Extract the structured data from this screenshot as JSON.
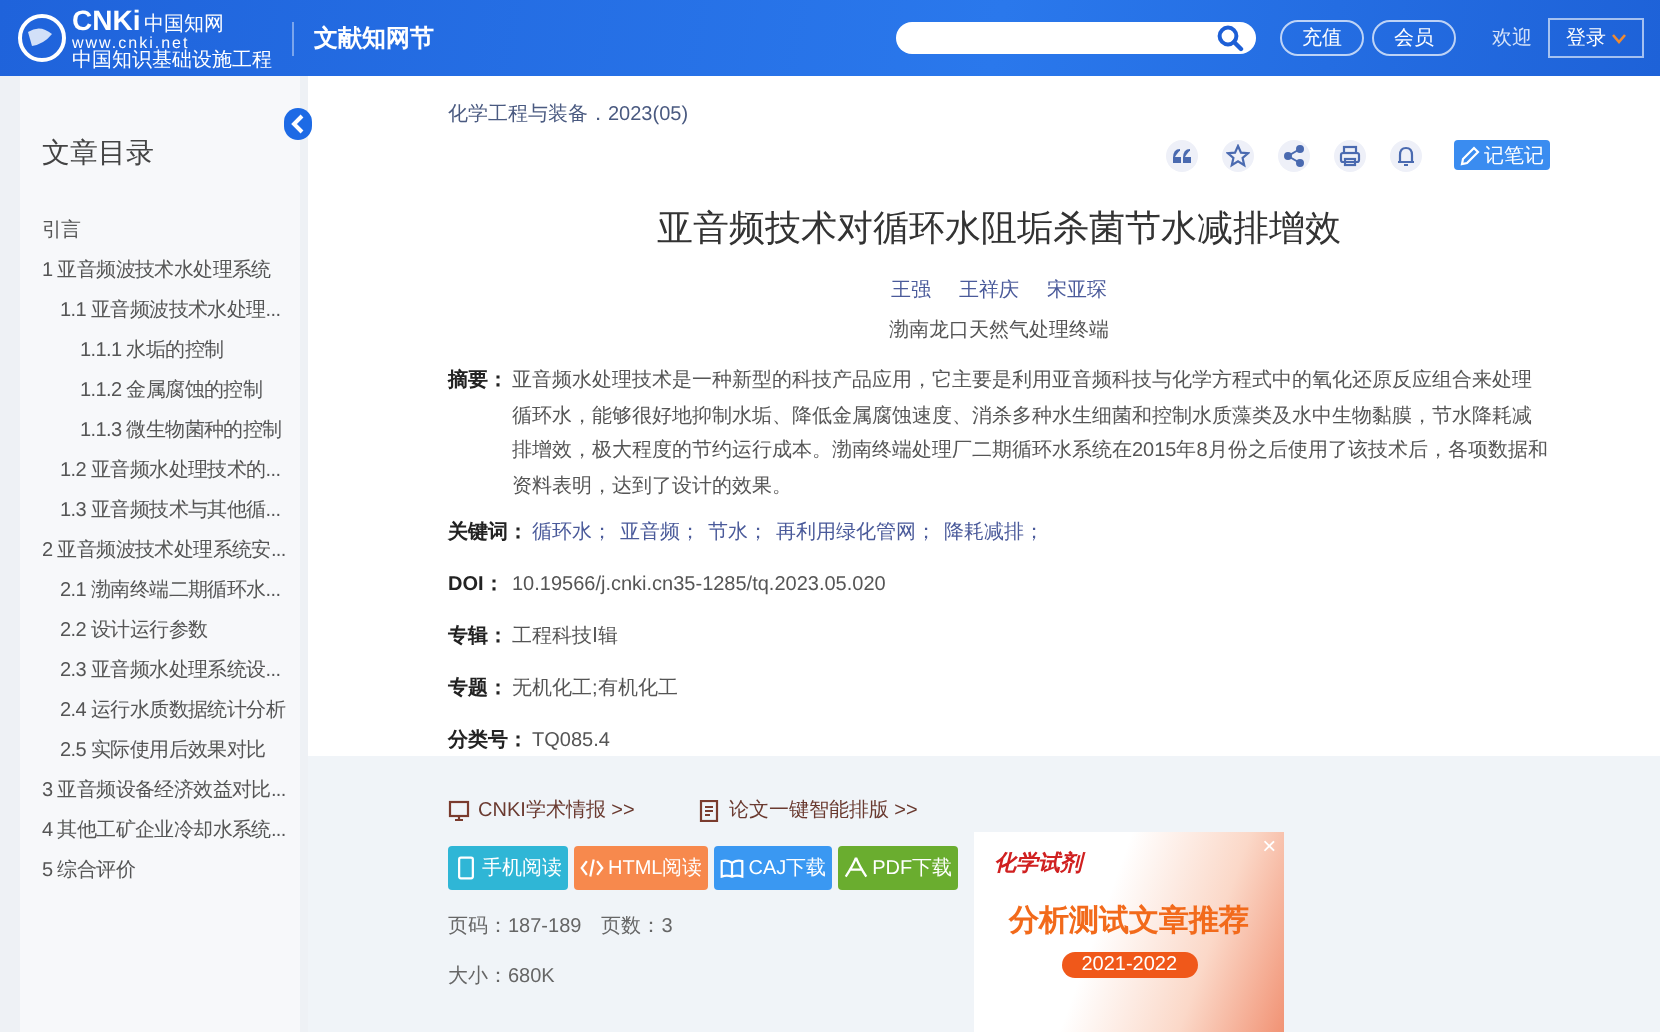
{
  "header": {
    "logo_mark": "CNKi",
    "logo_cn": "中国知网",
    "logo_url": "www.cnki.net",
    "logo_sub": "中国知识基础设施工程",
    "section": "文献知网节",
    "buttons": [
      "充值",
      "会员"
    ],
    "welcome": "欢迎",
    "login": "登录"
  },
  "toc": {
    "title": "文章目录",
    "items": [
      {
        "label": "引言"
      },
      {
        "label": "1 亚音频波技术水处理系统",
        "children": [
          {
            "label": "1.1 亚音频波技术水处理...",
            "children": [
              {
                "label": "1.1.1 水垢的控制"
              },
              {
                "label": "1.1.2 金属腐蚀的控制"
              },
              {
                "label": "1.1.3 微生物菌种的控制"
              }
            ]
          },
          {
            "label": "1.2 亚音频水处理技术的..."
          },
          {
            "label": "1.3 亚音频技术与其他循..."
          }
        ]
      },
      {
        "label": "2 亚音频波技术处理系统安...",
        "children": [
          {
            "label": "2.1 渤南终端二期循环水..."
          },
          {
            "label": "2.2 设计运行参数"
          },
          {
            "label": "2.3 亚音频水处理系统设..."
          },
          {
            "label": "2.4 运行水质数据统计分析"
          },
          {
            "label": "2.5 实际使用后效果对比"
          }
        ]
      },
      {
        "label": "3 亚音频设备经济效益对比..."
      },
      {
        "label": "4 其他工矿企业冷却水系统..."
      },
      {
        "label": "5 综合评价"
      }
    ]
  },
  "article": {
    "source": "化学工程与装备．2023(05)",
    "tools": [
      {
        "kind": "quote"
      },
      {
        "kind": "star"
      },
      {
        "kind": "share"
      },
      {
        "kind": "print"
      },
      {
        "kind": "bell"
      }
    ],
    "note_button": "记笔记",
    "title": "亚音频技术对循环水阻垢杀菌节水减排增效",
    "authors": [
      "王强",
      "王祥庆",
      "宋亚琛"
    ],
    "affiliation": "渤南龙口天然气处理终端",
    "abstract_label": "摘要：",
    "abstract": "亚音频水处理技术是一种新型的科技产品应用，它主要是利用亚音频科技与化学方程式中的氧化还原反应组合来处理循环水，能够很好地抑制水垢、降低金属腐蚀速度、消杀多种水生细菌和控制水质藻类及水中生物黏膜，节水降耗减排增效，极大程度的节约运行成本。渤南终端处理厂二期循环水系统在2015年8月份之后使用了该技术后，各项数据和资料表明，达到了设计的效果。",
    "keywords_label": "关键词：",
    "keywords": [
      "循环水；",
      "亚音频；",
      "节水；",
      "再利用绿化管网；",
      "降耗减排；"
    ],
    "meta": [
      {
        "label": "DOI：",
        "value": "10.19566/j.cnki.cn35-1285/tq.2023.05.020"
      },
      {
        "label": "专辑：",
        "value": "工程科技Ⅰ辑"
      },
      {
        "label": "专题：",
        "value": "无机化工;有机化工"
      },
      {
        "label": "分类号：",
        "value": "TQ085.4"
      }
    ]
  },
  "downloads": {
    "links": [
      {
        "kind": "monitor",
        "label": "CNKI学术情报 >>"
      },
      {
        "kind": "doc",
        "label": "论文一键智能排版 >>"
      }
    ],
    "buttons": [
      {
        "kind": "phone",
        "label": "手机阅读",
        "color": "#2fb6d6"
      },
      {
        "kind": "code",
        "label": "HTML阅读",
        "color": "#f7894d"
      },
      {
        "kind": "book",
        "label": "CAJ下载",
        "color": "#3a98f2"
      },
      {
        "kind": "pdf",
        "label": "PDF下载",
        "color": "#6aad2f"
      }
    ],
    "info": [
      [
        "页码：187-189",
        "页数：3"
      ],
      [
        "大小：680K"
      ]
    ]
  },
  "ad": {
    "brand": "化学试剂",
    "headline": "分析测试文章推荐",
    "years": "2021-2022",
    "close": "×"
  }
}
